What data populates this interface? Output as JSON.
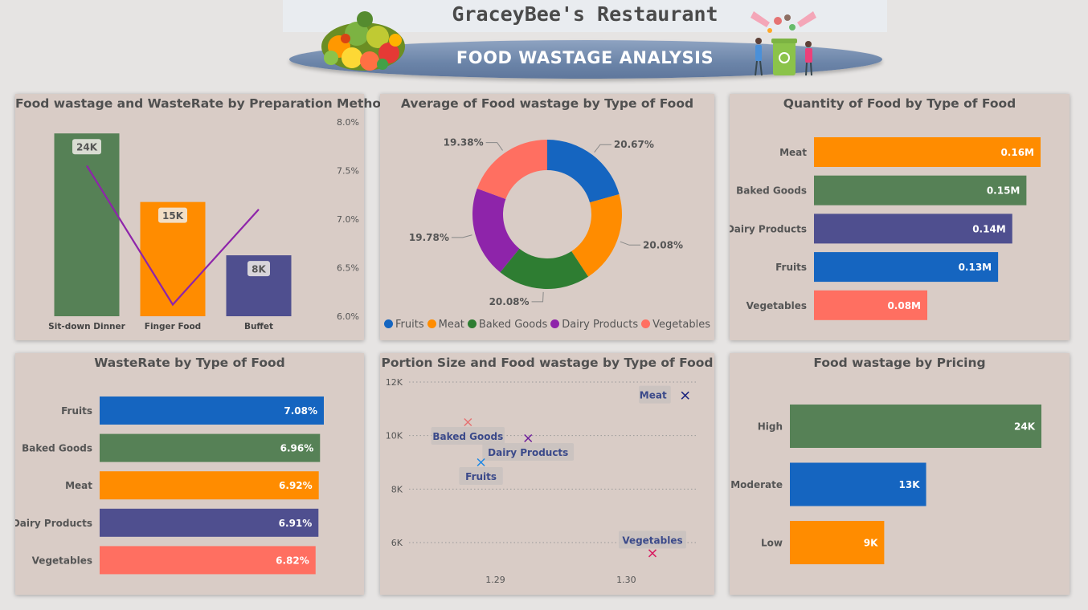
{
  "header": {
    "restaurant_name": "GraceyBee's Restaurant",
    "dashboard_title": "FOOD WASTAGE ANALYSIS"
  },
  "colors": {
    "panel_bg": "#d9ccc6",
    "page_bg": "#e6e4e3",
    "green": "#568156",
    "orange": "#ff8c00",
    "purple_blue": "#4f4f8f",
    "blue": "#1565c0",
    "salmon": "#ff6f61",
    "line_purple": "#8e24aa",
    "donut_green": "#2e7d32",
    "donut_purple": "#8e24aa"
  },
  "chart_data": [
    {
      "id": "prep",
      "type": "bar",
      "title": "Food wastage and WasteRate by Preparation Method",
      "categories": [
        "Sit-down Dinner",
        "Finger Food",
        "Buffet"
      ],
      "series": [
        {
          "values": [
            24000,
            15000,
            8000
          ],
          "labels": [
            "24K",
            "15K",
            "8K"
          ],
          "colors": [
            "#568156",
            "#ff8c00",
            "#4f4f8f"
          ]
        },
        {
          "type": "line",
          "values": [
            7.55,
            6.12,
            7.1
          ],
          "color": "#8e24aa"
        }
      ],
      "ylim": [
        0,
        25500
      ],
      "y2lim": [
        6.0,
        8.0
      ],
      "y2_ticks": [
        "8.0%",
        "7.5%",
        "7.0%",
        "6.5%",
        "6.0%"
      ],
      "grid": false
    },
    {
      "id": "donut",
      "type": "pie",
      "title": "Average of Food wastage by Type of Food",
      "categories": [
        "Fruits",
        "Meat",
        "Baked Goods",
        "Dairy Products",
        "Vegetables"
      ],
      "values": [
        20.67,
        20.08,
        20.08,
        19.78,
        19.38
      ],
      "labels": [
        "20.67%",
        "20.08%",
        "20.08%",
        "19.78%",
        "19.38%"
      ],
      "colors": [
        "#1565c0",
        "#ff8c00",
        "#2e7d32",
        "#8e24aa",
        "#ff6f61"
      ],
      "legend": "bottom"
    },
    {
      "id": "qty",
      "type": "bar",
      "orientation": "horizontal",
      "title": "Quantity of Food by Type of Food",
      "categories": [
        "Meat",
        "Baked Goods",
        "Dairy Products",
        "Fruits",
        "Vegetables"
      ],
      "values": [
        0.16,
        0.15,
        0.14,
        0.13,
        0.08
      ],
      "labels": [
        "0.16M",
        "0.15M",
        "0.14M",
        "0.13M",
        "0.08M"
      ],
      "colors": [
        "#ff8c00",
        "#568156",
        "#4f4f8f",
        "#1565c0",
        "#ff6f61"
      ],
      "xlim": [
        0,
        0.16
      ]
    },
    {
      "id": "rate",
      "type": "bar",
      "orientation": "horizontal",
      "title": "WasteRate by Type of Food",
      "categories": [
        "Fruits",
        "Baked Goods",
        "Meat",
        "Dairy Products",
        "Vegetables"
      ],
      "values": [
        7.08,
        6.96,
        6.92,
        6.91,
        6.82
      ],
      "labels": [
        "7.08%",
        "6.96%",
        "6.92%",
        "6.91%",
        "6.82%"
      ],
      "colors": [
        "#1565c0",
        "#568156",
        "#ff8c00",
        "#4f4f8f",
        "#ff6f61"
      ],
      "xlim": [
        0,
        7.08
      ]
    },
    {
      "id": "scatter",
      "type": "scatter",
      "title": "Portion Size and Food wastage by Type of Food",
      "points": [
        {
          "name": "Meat",
          "x": 1.3045,
          "y": 11500,
          "color": "#1a237e"
        },
        {
          "name": "Baked Goods",
          "x": 1.2879,
          "y": 10500,
          "color": "#e57373"
        },
        {
          "name": "Dairy Products",
          "x": 1.2925,
          "y": 9900,
          "color": "#6a1b9a"
        },
        {
          "name": "Fruits",
          "x": 1.2889,
          "y": 9000,
          "color": "#1e88e5"
        },
        {
          "name": "Vegetables",
          "x": 1.302,
          "y": 5600,
          "color": "#d81b60"
        }
      ],
      "xlim": [
        1.2834,
        1.3055
      ],
      "ylim": [
        5000,
        12000
      ],
      "y_ticks": [
        "12K",
        "10K",
        "8K",
        "6K"
      ],
      "y_tick_values": [
        12000,
        10000,
        8000,
        6000
      ],
      "x_ticks": [
        "1.29",
        "1.30"
      ],
      "x_tick_values": [
        1.29,
        1.3
      ],
      "grid": true
    },
    {
      "id": "pricing",
      "type": "bar",
      "orientation": "horizontal",
      "title": "Food wastage by Pricing",
      "categories": [
        "High",
        "Moderate",
        "Low"
      ],
      "values": [
        24000,
        13000,
        9000
      ],
      "labels": [
        "24K",
        "13K",
        "9K"
      ],
      "colors": [
        "#568156",
        "#1565c0",
        "#ff8c00"
      ],
      "xlim": [
        0,
        24000
      ]
    }
  ]
}
